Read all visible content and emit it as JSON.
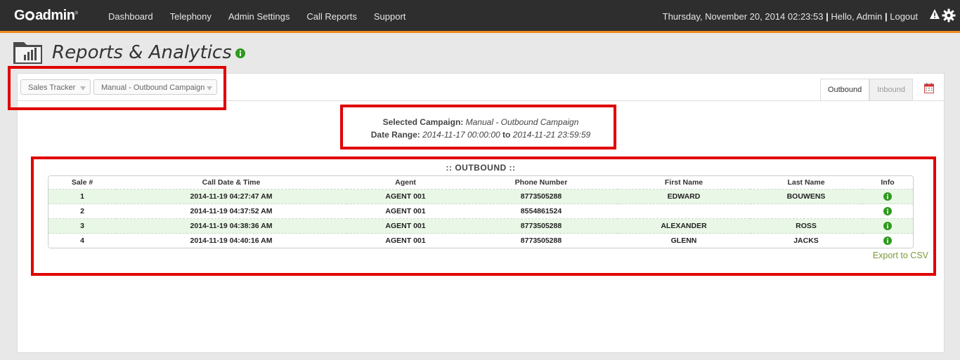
{
  "app": {
    "logo": "GOadmin",
    "nav": [
      "Dashboard",
      "Telephony",
      "Admin Settings",
      "Call Reports",
      "Support"
    ],
    "datetime": "Thursday, November 20, 2014 02:23:53",
    "greeting": "Hello, Admin",
    "logout": "Logout",
    "icons": [
      "warning-icon",
      "gear-icon"
    ]
  },
  "page": {
    "title": "Reports & Analytics"
  },
  "toolbar": {
    "report_select": "Sales Tracker",
    "campaign_select": "Manual - Outbound Campaign",
    "tabs": [
      "Outbound",
      "Inbound"
    ],
    "active_tab": "Outbound"
  },
  "campaign": {
    "selected_label": "Selected Campaign:",
    "selected_value": "Manual - Outbound Campaign",
    "range_label": "Date Range:",
    "range_start": "2014-11-17 00:00:00",
    "range_to": "to",
    "range_end": "2014-11-21 23:59:59"
  },
  "outbound": {
    "title": ":: OUTBOUND ::",
    "columns": [
      "Sale #",
      "Call Date & Time",
      "Agent",
      "Phone Number",
      "First Name",
      "Last Name",
      "Info"
    ],
    "rows": [
      {
        "sale": "1",
        "datetime": "2014-11-19 04:27:47 AM",
        "agent": "AGENT 001",
        "phone": "8773505288",
        "first": "EDWARD",
        "last": "BOUWENS"
      },
      {
        "sale": "2",
        "datetime": "2014-11-19 04:37:52 AM",
        "agent": "AGENT 001",
        "phone": "8554861524",
        "first": "",
        "last": ""
      },
      {
        "sale": "3",
        "datetime": "2014-11-19 04:38:36 AM",
        "agent": "AGENT 001",
        "phone": "8773505288",
        "first": "ALEXANDER",
        "last": "ROSS"
      },
      {
        "sale": "4",
        "datetime": "2014-11-19 04:40:16 AM",
        "agent": "AGENT 001",
        "phone": "8773505288",
        "first": "GLENN",
        "last": "JACKS"
      }
    ],
    "export": "Export to CSV"
  },
  "colors": {
    "topbar": "#2e2e2e",
    "accent": "#f08c1e",
    "row_green": "#e9f7e6",
    "info_green": "#2e9a1e",
    "export_link": "#7a9a3a",
    "annotation": "#e00000"
  }
}
